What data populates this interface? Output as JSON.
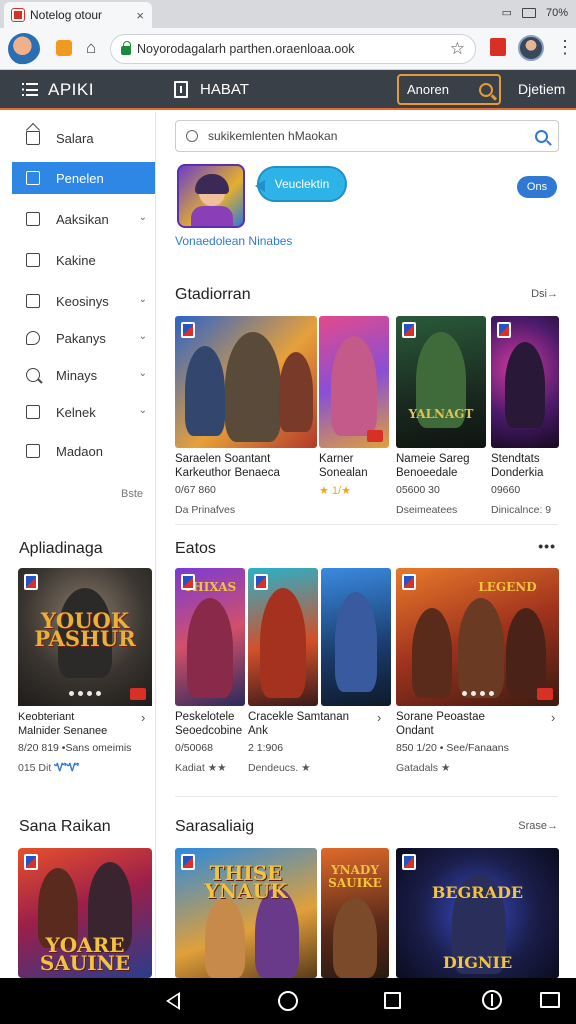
{
  "browser": {
    "tab_title": "Notelog otour",
    "status_right": "70%",
    "url": "Noyorodagalarh parthen.oraenloaa.ook"
  },
  "appbar": {
    "title": "APIKI",
    "nav_label": "HABAT",
    "search_label": "Anoren",
    "right_label": "Djetiem"
  },
  "sidebar": {
    "items": [
      {
        "label": "Salara",
        "chevron": false
      },
      {
        "label": "Penelen",
        "chevron": false
      },
      {
        "label": "Aaksikan",
        "chevron": true
      },
      {
        "label": "Kakine",
        "chevron": false
      },
      {
        "label": "Keosinys",
        "chevron": true
      },
      {
        "label": "Pakanys",
        "chevron": true
      },
      {
        "label": "Minays",
        "chevron": true
      },
      {
        "label": "Kelnek",
        "chevron": true
      },
      {
        "label": "Madaon",
        "chevron": false
      }
    ],
    "footer": "Bste",
    "section1": {
      "title": "Apliadinaga",
      "card": {
        "art_text": "YOUOK\nPASHUR",
        "name": "Keobteriant\nMalnider Senanee",
        "meta": "8/20 819 •Sans omeimis",
        "sub": "015 Dit"
      }
    },
    "section2": {
      "title": "Sana Raikan",
      "art_text": "YOARE\nSAUINE"
    }
  },
  "main": {
    "search_text": "sukikemlenten hMaokan",
    "featured": {
      "bubble": "Veuclektin",
      "caption": "Vonaedolean Ninabes",
      "get": "Ons"
    },
    "sections": [
      {
        "title": "Gtadiorran",
        "more": "Dsi→",
        "cards": [
          {
            "name": "Saraelen Soantant\nKarkeuthor Benaeca",
            "meta": "0/67 860",
            "sub": "Da Prinafves"
          },
          {
            "name": "Karner\nSonealan",
            "meta": "★ 1/★",
            "sub": ""
          },
          {
            "name": "Nameie Sareg\nBenoeedale",
            "meta": "05600 30",
            "sub": "Dseimeatees"
          },
          {
            "name": "Stendtats\nDonderkia",
            "meta": "09660",
            "sub": "Dinicalnce: 9"
          }
        ]
      },
      {
        "title": "Eatos",
        "more": "•••",
        "cards": [
          {
            "name": "Peskelotele\nSeoedcobine",
            "meta": "0/50068",
            "sub": "Kadiat ★★"
          },
          {
            "name": "Cracekle Samtanan\nAnk",
            "meta": "2 1:906",
            "sub": "Dendeucs. ★"
          },
          {
            "name": "Sorane Peoastae\nOndant",
            "meta": "850 1/20 • See/Fanaans",
            "sub": "Gatadals ★"
          }
        ]
      },
      {
        "title": "Sarasaliaig",
        "more": "Srase→",
        "art_texts": [
          "THISE\nYNAUK",
          "YNADY\nSAUIKE",
          "BEGRADE\nDIGNIE"
        ]
      }
    ]
  }
}
